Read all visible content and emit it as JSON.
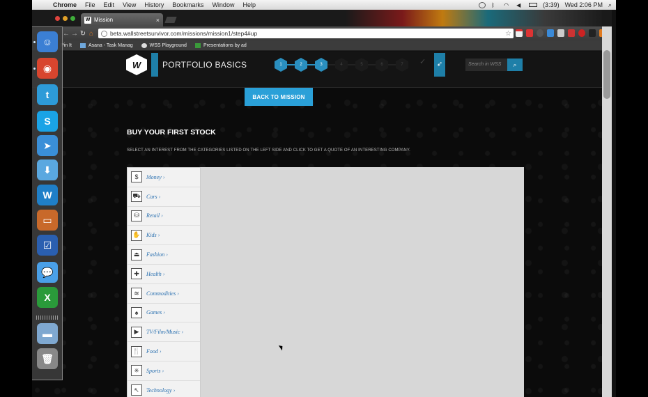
{
  "menubar": {
    "app": "Chrome",
    "items": [
      "File",
      "Edit",
      "View",
      "History",
      "Bookmarks",
      "Window",
      "Help"
    ],
    "battery": "(3:39)",
    "clock": "Wed 2:06 PM"
  },
  "browser": {
    "tab_title": "Mission",
    "tab_favicon": "W",
    "url": "beta.wallstreetsurvivor.com/missions/mission1/step4#up",
    "bookmarks": [
      "Pin It",
      "Asana - Task Manag",
      "WSS Playground",
      "Presentations by ad"
    ]
  },
  "site": {
    "logo_letter": "W",
    "course_title": "PORTFOLIO BASICS",
    "steps": [
      "1",
      "2",
      "3",
      "4",
      "5",
      "6",
      "7"
    ],
    "active_steps": 3,
    "search_placeholder": "Search in WSS",
    "back_button": "BACK TO MISSION",
    "heading": "BUY YOUR FIRST STOCK",
    "instruction": "SELECT AN INTEREST FROM THE CATEGORIES LISTED ON THE LEFT SIDE AND CLICK TO GET A QUOTE OF AN INTERESTING COMPANY.",
    "categories": [
      {
        "label": "Money ›",
        "icon": "dollar-icon",
        "glyph": "$"
      },
      {
        "label": "Cars ›",
        "icon": "car-icon",
        "glyph": "⛟"
      },
      {
        "label": "Retail ›",
        "icon": "cart-icon",
        "glyph": "⛁"
      },
      {
        "label": "Kids ›",
        "icon": "hand-icon",
        "glyph": "✋"
      },
      {
        "label": "Fashion ›",
        "icon": "hanger-icon",
        "glyph": "⏏"
      },
      {
        "label": "Health ›",
        "icon": "medical-cross-icon",
        "glyph": "✚"
      },
      {
        "label": "Commodities ›",
        "icon": "commodities-icon",
        "glyph": "≋"
      },
      {
        "label": "Games ›",
        "icon": "spade-icon",
        "glyph": "♠"
      },
      {
        "label": "TV/Film/Music ›",
        "icon": "media-play-icon",
        "glyph": "▶"
      },
      {
        "label": "Food ›",
        "icon": "fork-knife-icon",
        "glyph": "🍴"
      },
      {
        "label": "Sports ›",
        "icon": "ball-icon",
        "glyph": "✳"
      },
      {
        "label": "Technology ›",
        "icon": "cursor-icon",
        "glyph": "↖"
      }
    ]
  },
  "dock": {
    "apps": [
      {
        "name": "finder-icon",
        "glyph": "☺",
        "color": "#3b7fd4"
      },
      {
        "name": "chrome-icon",
        "glyph": "◉",
        "color": "#d8452e"
      },
      {
        "name": "twitter-icon",
        "glyph": "t",
        "color": "#2d9bd8"
      },
      {
        "name": "skype-icon",
        "glyph": "S",
        "color": "#1aa3e6"
      },
      {
        "name": "paper-plane-icon",
        "glyph": "➤",
        "color": "#3a8fd8"
      },
      {
        "name": "download-arrow-icon",
        "glyph": "⬇",
        "color": "#5aa8e0"
      },
      {
        "name": "wss-w-icon",
        "glyph": "W",
        "color": "#1f7fc8"
      },
      {
        "name": "slideshow-icon",
        "glyph": "▭",
        "color": "#c8692a"
      },
      {
        "name": "checkbox-app-icon",
        "glyph": "☑",
        "color": "#2a5fb0"
      },
      {
        "name": "messages-icon",
        "glyph": "💬",
        "color": "#4aa0e8"
      },
      {
        "name": "excel-icon",
        "glyph": "X",
        "color": "#2a9a3a"
      },
      {
        "name": "folder-icon",
        "glyph": "▬",
        "color": "#7fa8d0"
      },
      {
        "name": "trash-icon",
        "glyph": "🗑",
        "color": "#888888"
      }
    ]
  }
}
